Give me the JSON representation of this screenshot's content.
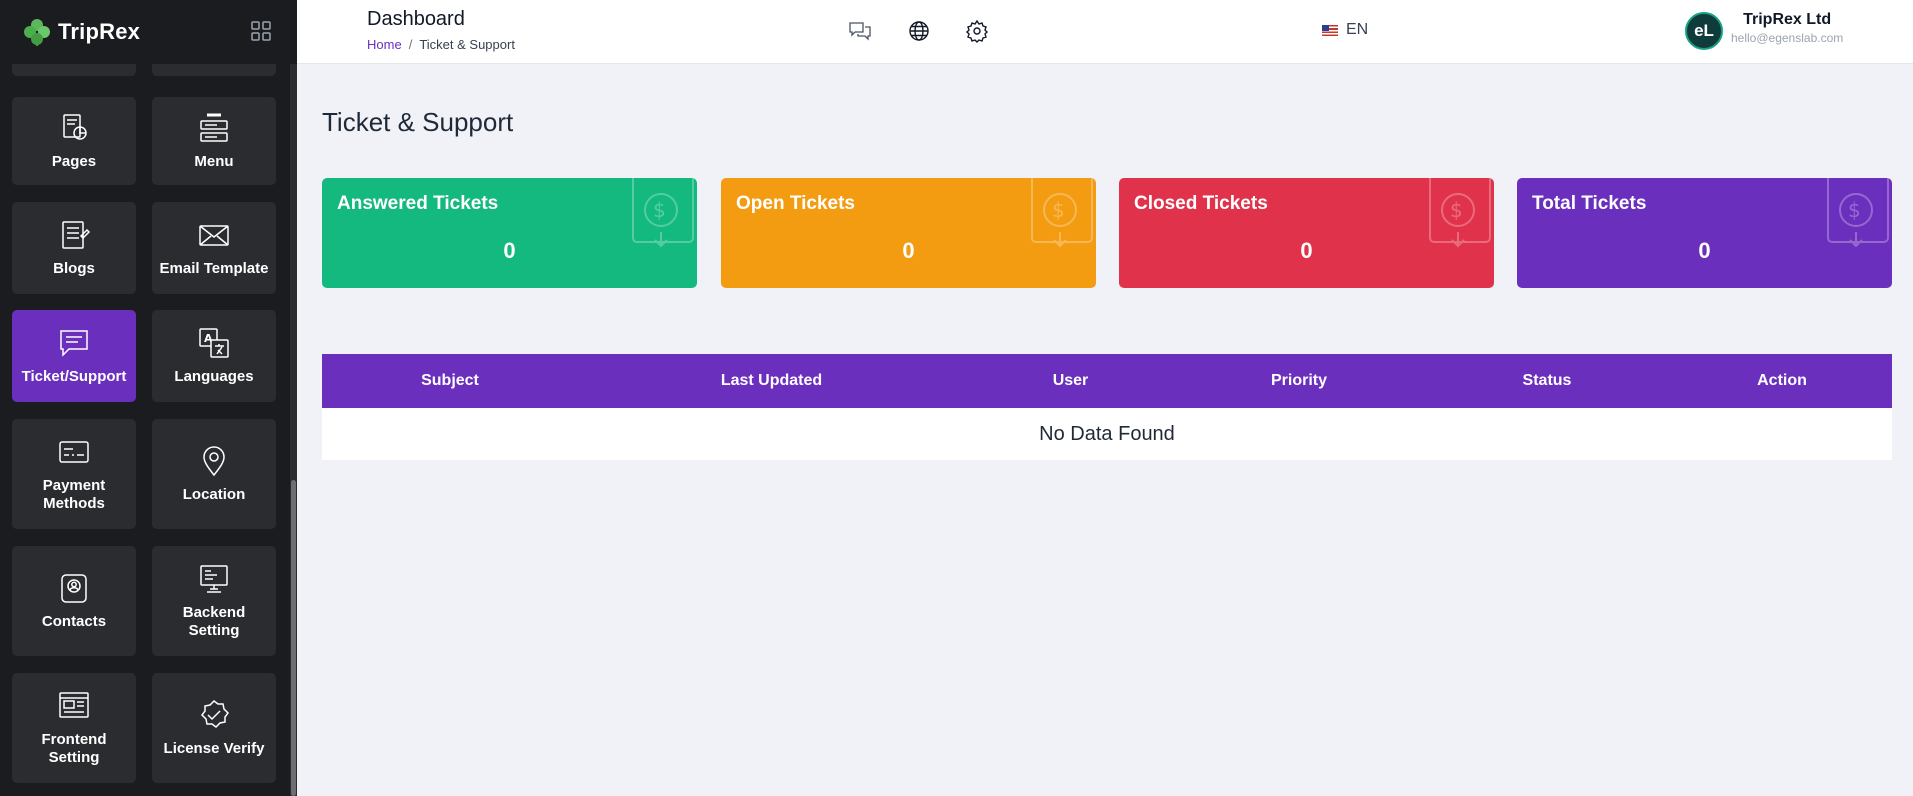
{
  "brand": {
    "name": "TripRex",
    "accent": "#6b2fbd"
  },
  "header": {
    "title": "Dashboard",
    "breadcrumb": {
      "home": "Home",
      "separator": "/",
      "current": "Ticket & Support"
    },
    "language": "EN",
    "user": {
      "initials": "eL",
      "name": "TripRex Ltd",
      "email": "hello@egenslab.com"
    }
  },
  "sidebar": {
    "tiles": [
      {
        "label": "Pages",
        "icon": "pages-icon"
      },
      {
        "label": "Menu",
        "icon": "menu-icon"
      },
      {
        "label": "Blogs",
        "icon": "blogs-icon"
      },
      {
        "label": "Email Template",
        "icon": "email-icon"
      },
      {
        "label": "Ticket/Support",
        "icon": "ticket-icon",
        "active": true
      },
      {
        "label": "Languages",
        "icon": "languages-icon"
      },
      {
        "label": "Payment Methods",
        "icon": "payment-icon"
      },
      {
        "label": "Location",
        "icon": "location-icon"
      },
      {
        "label": "Contacts",
        "icon": "contacts-icon"
      },
      {
        "label": "Backend Setting",
        "icon": "backend-icon"
      },
      {
        "label": "Frontend Setting",
        "icon": "frontend-icon"
      },
      {
        "label": "License Verify",
        "icon": "license-icon"
      }
    ]
  },
  "main": {
    "title": "Ticket & Support",
    "cards": [
      {
        "label": "Answered Tickets",
        "value": "0",
        "color": "#13b97f"
      },
      {
        "label": "Open Tickets",
        "value": "0",
        "color": "#f39c12"
      },
      {
        "label": "Closed Tickets",
        "value": "0",
        "color": "#e0334b"
      },
      {
        "label": "Total Tickets",
        "value": "0",
        "color": "#6b2fbd"
      }
    ],
    "table": {
      "columns": [
        "Subject",
        "Last Updated",
        "User",
        "Priority",
        "Status",
        "Action"
      ],
      "empty_text": "No Data Found"
    }
  }
}
